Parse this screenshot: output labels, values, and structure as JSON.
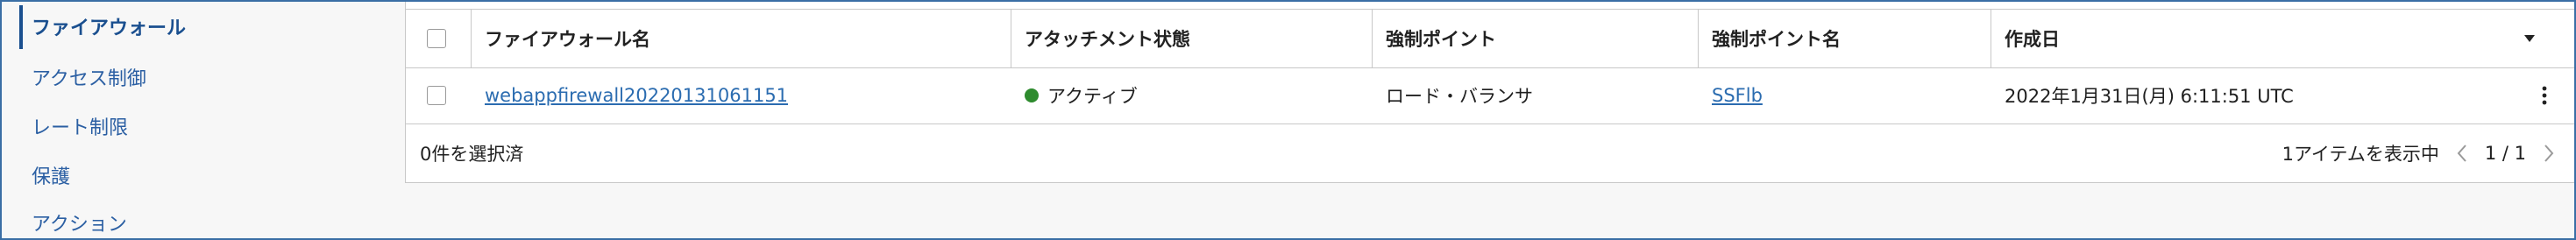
{
  "sidebar": {
    "items": [
      {
        "label": "ファイアウォール",
        "active": true
      },
      {
        "label": "アクセス制御"
      },
      {
        "label": "レート制限"
      },
      {
        "label": "保護"
      },
      {
        "label": "アクション"
      }
    ]
  },
  "table": {
    "columns": [
      "ファイアウォール名",
      "アタッチメント状態",
      "強制ポイント",
      "強制ポイント名",
      "作成日"
    ],
    "rows": [
      {
        "name": "webappfirewall20220131061151",
        "status": "アクティブ",
        "status_color": "#2e8b2e",
        "enforcement_point": "ロード・バランサ",
        "enforcement_point_name": "SSFlb",
        "created": "2022年1月31日(月) 6:11:51 UTC"
      }
    ]
  },
  "footer": {
    "selected": "0件を選択済",
    "showing": "1アイテムを表示中",
    "page": "1 / 1"
  },
  "icons": {
    "sort": "chevron-down-icon",
    "row_menu": "kebab-menu-icon",
    "prev": "chevron-left-icon",
    "next": "chevron-right-icon"
  }
}
